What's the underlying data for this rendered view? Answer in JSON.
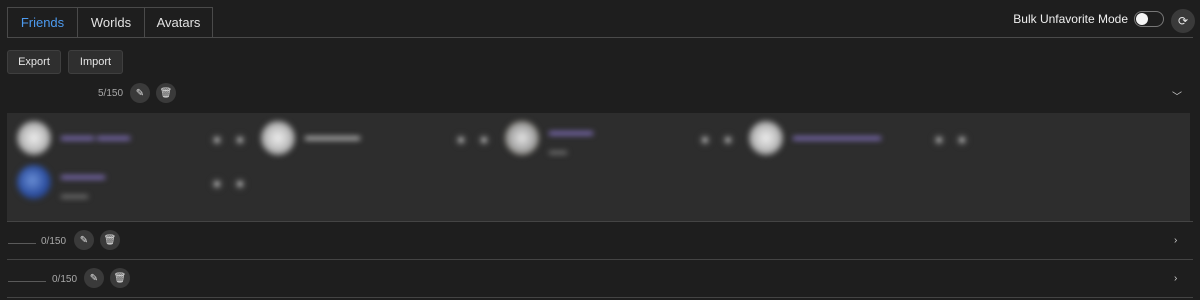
{
  "tabs": [
    {
      "label": "Friends",
      "active": true
    },
    {
      "label": "Worlds",
      "active": false
    },
    {
      "label": "Avatars",
      "active": false
    }
  ],
  "bulk_unfavorite": {
    "label": "Bulk Unfavorite Mode",
    "enabled": false
  },
  "toolbar": {
    "export_label": "Export",
    "import_label": "Import"
  },
  "groups": [
    {
      "count_text": "5/150",
      "expanded": true
    },
    {
      "count_text": "0/150",
      "expanded": false
    },
    {
      "count_text": "0/150",
      "expanded": false
    }
  ],
  "colors": {
    "accent": "#4d9bf0",
    "background": "#1e1e1e",
    "panel": "#2d2d2d",
    "name_purple": "#8e7ad2"
  },
  "icons": {
    "refresh": "refresh-icon",
    "edit": "pencil-icon",
    "delete": "trash-icon",
    "expand": "chevron-down-icon",
    "collapse": "chevron-right-icon"
  }
}
